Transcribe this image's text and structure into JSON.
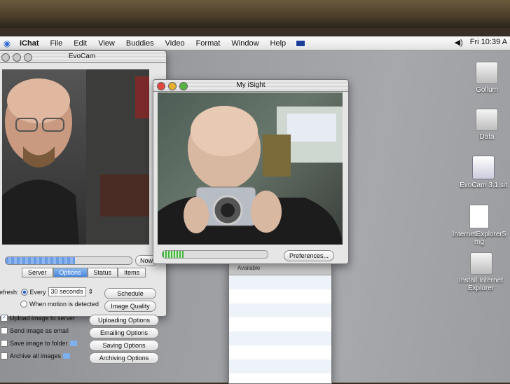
{
  "menubar": {
    "app": "iChat",
    "items": [
      "File",
      "Edit",
      "View",
      "Buddies",
      "Video",
      "Format",
      "Window",
      "Help"
    ],
    "clock": "Fri 10:39 A"
  },
  "evocam": {
    "title": "EvoCam",
    "now_button": "Now",
    "progress_fraction": 0.55,
    "tabs": [
      "Server",
      "Options",
      "Status",
      "Items"
    ],
    "selected_tab": "Options",
    "refresh_label": "efresh:",
    "every_label": "Every",
    "interval_value": "30 seconds",
    "motion_label": "When motion is detected",
    "schedule_button": "Schedule",
    "image_quality_button": "Image Quality",
    "upload_label": "Upload image to server",
    "uploading_options": "Uploading Options",
    "email_label": "Send image as email",
    "emailing_options": "Emailing Options",
    "save_label": "Save image to folder",
    "saving_options": "Saving Options",
    "archive_label": "Archive all images",
    "archiving_options": "Archiving Options"
  },
  "isight": {
    "title": "My iSight",
    "level_fraction": 0.2,
    "preferences_button": "Preferences..."
  },
  "buddy": {
    "status": "Available"
  },
  "desktop": {
    "icons": [
      "Gollum",
      "Data",
      "EvoCam 3.1.sit",
      "InternetExplorer5 mg",
      "Install Internet Explorer"
    ]
  }
}
